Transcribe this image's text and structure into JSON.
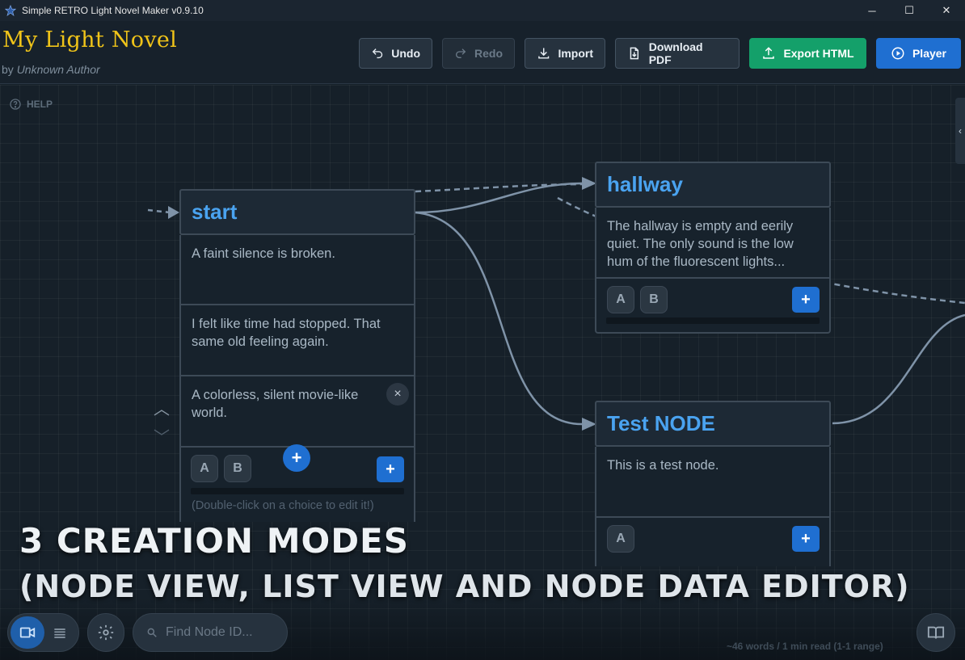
{
  "window": {
    "title": "Simple RETRO Light Novel Maker v0.9.10",
    "controls": [
      "─",
      "☐",
      "✕"
    ]
  },
  "header": {
    "novel_title": "My Light Novel",
    "by_label": "by",
    "author": "Unknown Author",
    "buttons": {
      "undo": "Undo",
      "redo": "Redo",
      "import": "Import",
      "download_pdf": "Download PDF",
      "export_html": "Export HTML",
      "player": "Player"
    }
  },
  "canvas": {
    "help": "HELP",
    "side_tab_glyph": "‹",
    "nodes": {
      "start": {
        "title": "start",
        "scenes": [
          "A faint silence is broken.",
          "I felt like time had stopped. That same old feeling again.",
          "A colorless, silent movie-like world."
        ],
        "choices": [
          "A",
          "B"
        ],
        "hint": "(Double-click on a choice to edit it!)"
      },
      "hallway": {
        "title": "hallway",
        "scenes": [
          "The hallway is empty and eerily quiet. The only sound is the low hum of the fluorescent lights..."
        ],
        "choices": [
          "A",
          "B"
        ]
      },
      "test": {
        "title": "Test NODE",
        "scenes": [
          "This is a test node."
        ],
        "choices": [
          "A"
        ]
      }
    },
    "add_glyph": "+",
    "close_glyph": "×",
    "up_glyph": "︿",
    "down_glyph": "﹀"
  },
  "caption": {
    "line1": "3 CREATION MODES",
    "line2": "(NODE VIEW, LIST VIEW AND NODE DATA EDITOR)"
  },
  "bottom": {
    "search_placeholder": "Find Node ID...",
    "word_count": "~46 words / 1 min read (1-1 range)"
  },
  "colors": {
    "accent_blue": "#1f6fd1",
    "export_green": "#14a06a",
    "title_gold": "#f0c419",
    "node_title": "#4aa3f0"
  }
}
